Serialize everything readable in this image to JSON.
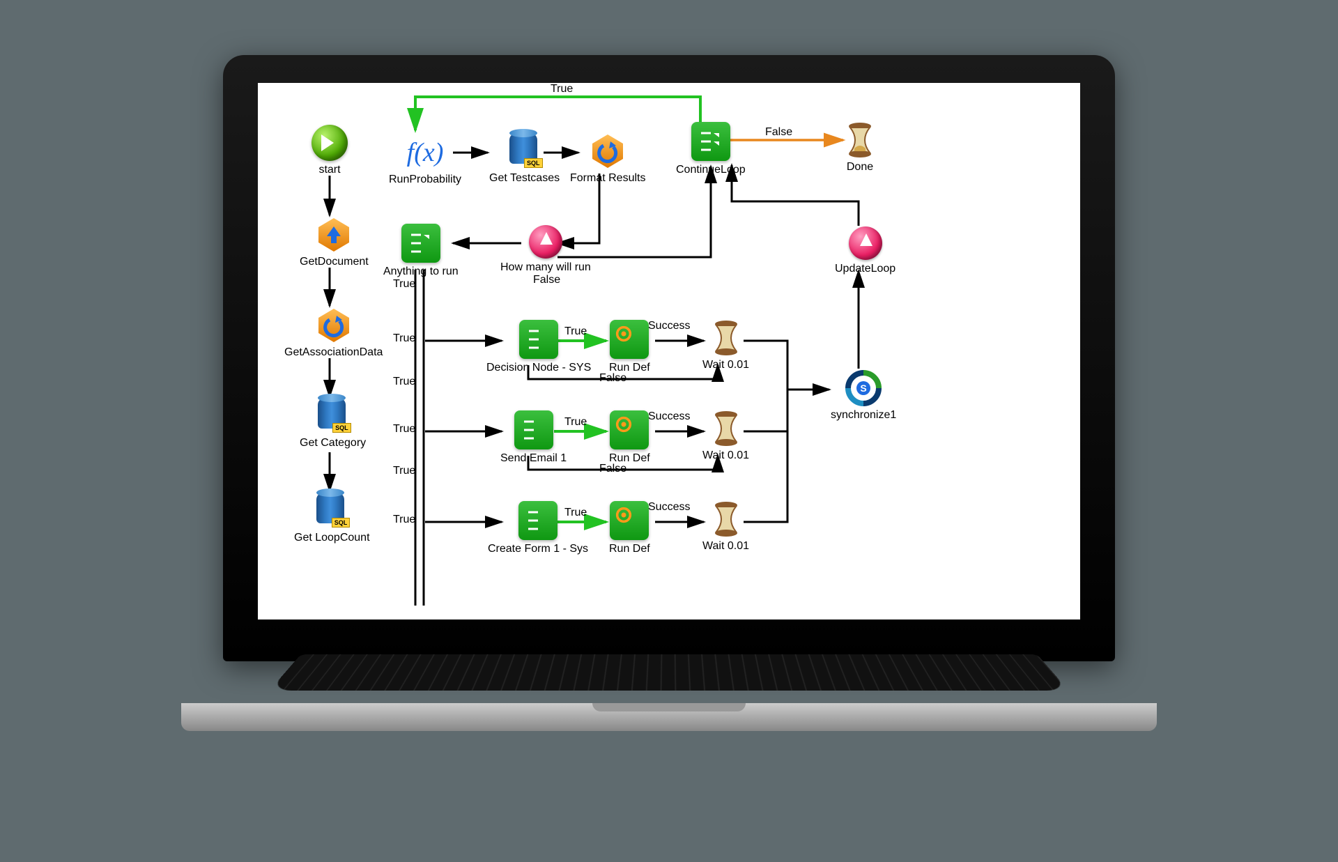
{
  "nodes": {
    "start": "start",
    "getDocument": "GetDocument",
    "getAssociationData": "GetAssociationData",
    "getCategory": "Get Category",
    "getLoopCount": "Get LoopCount",
    "runProbability": "RunProbability",
    "getTestcases": "Get Testcases",
    "formatResults": "Format Results",
    "anythingToRun": "Anything to run",
    "howManyWillRun": "How many will run",
    "decisionNodeSys": "Decision Node - SYS",
    "sendEmail1": "Send Email 1",
    "createForm1Sys": "Create Form 1 - Sys",
    "runDef1": "Run Def",
    "runDef2": "Run Def",
    "runDef3": "Run Def",
    "wait1": "Wait 0.01",
    "wait2": "Wait 0.01",
    "wait3": "Wait 0.01",
    "continueLoop": "ContinueLoop",
    "done": "Done",
    "updateLoop": "UpdateLoop",
    "synchronize1": "synchronize1"
  },
  "edges": {
    "trueTop": "True",
    "falseDone": "False",
    "trueAnything": "True",
    "falseHowMany": "False",
    "trueRow1a": "True",
    "trueRow1b": "True",
    "successRow1": "Success",
    "falseRow1": "False",
    "trueRow2a": "True",
    "trueRow2b": "True",
    "successRow2": "Success",
    "falseRow2": "False",
    "trueRow3a": "True",
    "trueRow3b": "True",
    "successRow3": "Success"
  },
  "icons": {
    "fx": "f(x)",
    "sql": "SQL"
  }
}
